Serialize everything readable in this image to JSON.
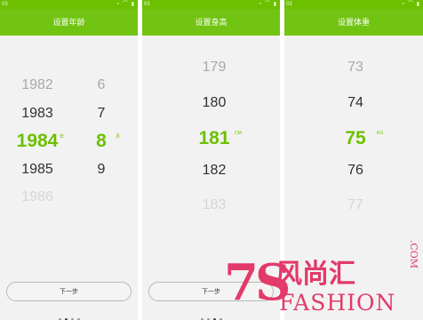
{
  "colors": {
    "accent": "#6cc000",
    "header": "#72c412",
    "background": "#f2f2f2",
    "watermark": "#e23a6a"
  },
  "screens": [
    {
      "statusbar": {
        "time": "03",
        "icons": "◔ ⌒ ▮"
      },
      "title": "设置年龄",
      "year_column": [
        "1982",
        "1983",
        "1984",
        "1985",
        "1986"
      ],
      "year_unit": "年",
      "month_column": [
        "6",
        "7",
        "8",
        "9"
      ],
      "month_unit": "月",
      "next_button": "下一步",
      "page_indicator": {
        "count": 4,
        "active": 1
      }
    },
    {
      "statusbar": {
        "time": "03",
        "icons": "◔ ⌒ ▮"
      },
      "title": "设置身高",
      "values": [
        "179",
        "180",
        "181",
        "182",
        "183"
      ],
      "unit": "CM",
      "next_button": "下一步",
      "page_indicator": {
        "count": 4,
        "active": 2
      }
    },
    {
      "statusbar": {
        "time": "03",
        "icons": "◔ ⌒ ▮"
      },
      "title": "设置体重",
      "values": [
        "73",
        "74",
        "75",
        "76",
        "77"
      ],
      "unit": "KG"
    }
  ],
  "watermark": {
    "logo_7s": "7S",
    "chinese": "风尚汇",
    "english": "FASHION",
    "domain": ".COM"
  }
}
